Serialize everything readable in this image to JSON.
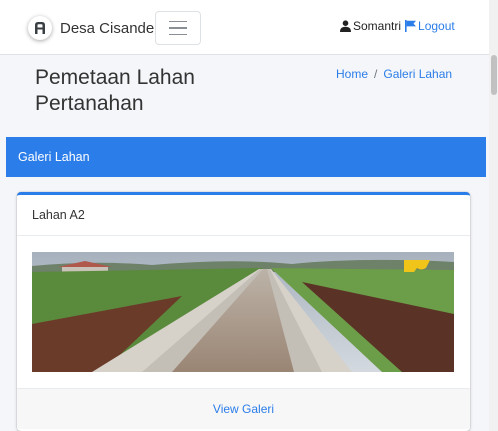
{
  "navbar": {
    "brand": "Desa Cisande",
    "user_name": "Somantri",
    "logout_label": "Logout"
  },
  "header": {
    "title": "Pemetaan Lahan Pertanahan",
    "breadcrumb": [
      "Home",
      "Galeri Lahan"
    ]
  },
  "section": {
    "title": "Galeri Lahan"
  },
  "card": {
    "title": "Lahan A2",
    "footer_link": "View Galeri"
  },
  "colors": {
    "accent": "#2b7de9",
    "background": "#f4f6f9",
    "card": "#ffffff"
  },
  "icons": [
    "brand-logo-icon",
    "hamburger-icon",
    "user-icon",
    "flag-icon"
  ]
}
